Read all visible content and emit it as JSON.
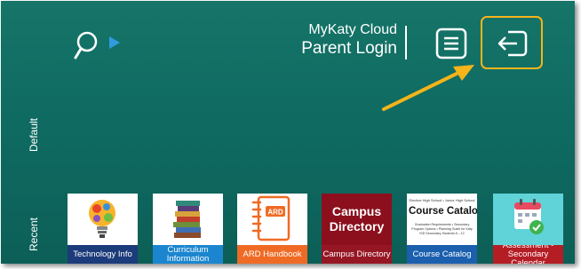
{
  "header": {
    "login_line1": "MyKaty Cloud",
    "login_line2": "Parent Login"
  },
  "icons": {
    "search": "search-icon",
    "expand": "triangle-right-icon",
    "menu": "menu-lines-icon",
    "logout": "logout-icon",
    "highlight_arrow": "arrow-icon"
  },
  "colors": {
    "panel_background": "#167468",
    "highlight": "#f4b41a"
  },
  "sections": {
    "default_label": "Default",
    "recent_label": "Recent"
  },
  "tiles": [
    {
      "caption": "Technology Info",
      "icon": "lightbulb-icon"
    },
    {
      "caption": "Curriculum Information",
      "icon": "book-stack-icon"
    },
    {
      "caption": "ARD Handbook",
      "icon": "notebook-icon",
      "badge": "ARD"
    },
    {
      "caption": "Campus Directory",
      "art_text": "Campus Directory"
    },
    {
      "caption": "Course Catalog",
      "art_title": "Course Catalog",
      "art_sub": "Elective High School • Junior High School",
      "art_foot": "Graduation Requirements • Secondary Program Options • Planning Guide for Katy ISD Secondary Students 8 – 12"
    },
    {
      "caption": "Assessment - Secondary Calendar",
      "icon": "calendar-check-icon"
    }
  ]
}
